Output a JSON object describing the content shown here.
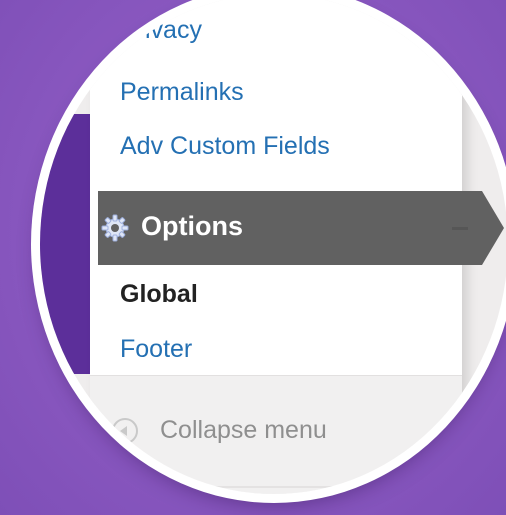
{
  "menu": {
    "items": [
      {
        "label": "Privacy"
      },
      {
        "label": "Permalinks"
      },
      {
        "label": "Adv Custom Fields"
      }
    ],
    "active": {
      "label": "Options",
      "icon": "gear-icon",
      "background": "#616161"
    },
    "submenu": [
      {
        "label": "Global",
        "current": true
      },
      {
        "label": "Footer",
        "current": false
      }
    ],
    "collapse": {
      "label": "Collapse menu",
      "icon": "collapse-arrow-icon"
    }
  },
  "colors": {
    "background": "#8a5ac0",
    "link": "#2470b3",
    "sidebar_accent": "#5c2f9a",
    "active_item": "#616161"
  }
}
